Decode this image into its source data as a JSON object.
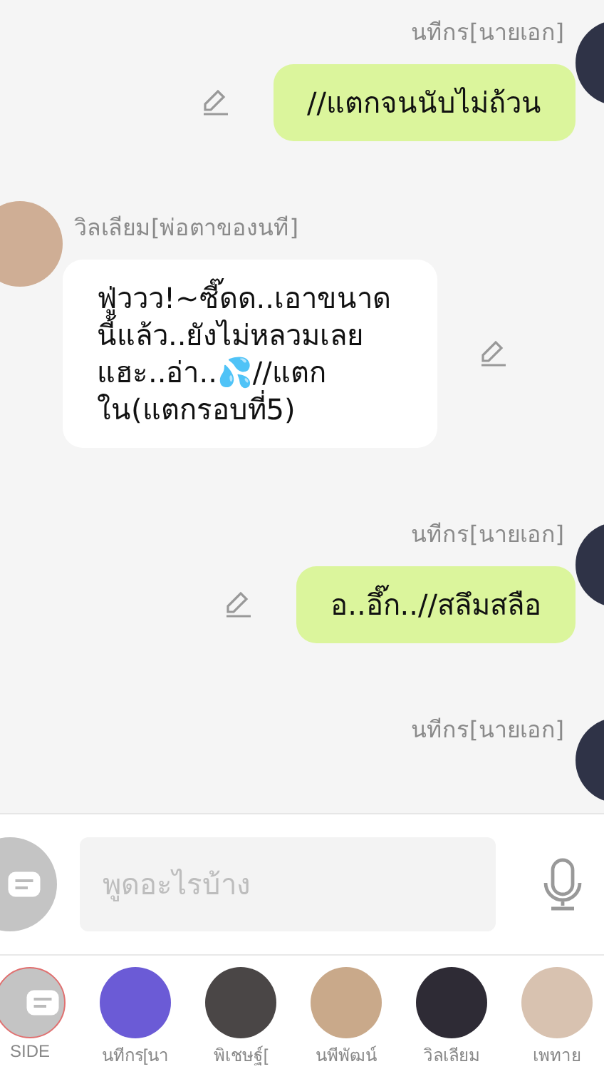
{
  "messages": [
    {
      "kind": "sent",
      "sender": "นทีกร[นายเอก]",
      "text": "//แตกจนนับไม่ถ้วน",
      "editable": true
    },
    {
      "kind": "received",
      "sender": "วิลเลียม[พ่อตาของนที]",
      "text": "ฟู่ววว!~ซี๊ดด..เอาขนาดนี้แล้ว..ยังไม่หลวมเลยแฮะ..อ่า..💦//แตกใน(แตกรอบที่5)",
      "editable": true
    },
    {
      "kind": "sent",
      "sender": "นทีกร[นายเอก]",
      "text": "อ..อึ๊ก..//สลึมสลือ",
      "editable": true
    },
    {
      "kind": "sent",
      "sender": "นทีกร[นายเอก]"
    }
  ],
  "composer": {
    "placeholder": "พูดอะไรบ้าง"
  },
  "contacts": [
    {
      "name": "SIDE",
      "kind": "side",
      "selected": true
    },
    {
      "name": "นทีกร[นา",
      "kind": "avatar",
      "selected": false
    },
    {
      "name": "พิเชษฐ์[",
      "kind": "avatar",
      "selected": false
    },
    {
      "name": "นพีพัฒน์",
      "kind": "avatar",
      "selected": false
    },
    {
      "name": "วิลเลียม",
      "kind": "avatar",
      "selected": false
    },
    {
      "name": "เพทาย",
      "kind": "avatar",
      "selected": false
    }
  ]
}
